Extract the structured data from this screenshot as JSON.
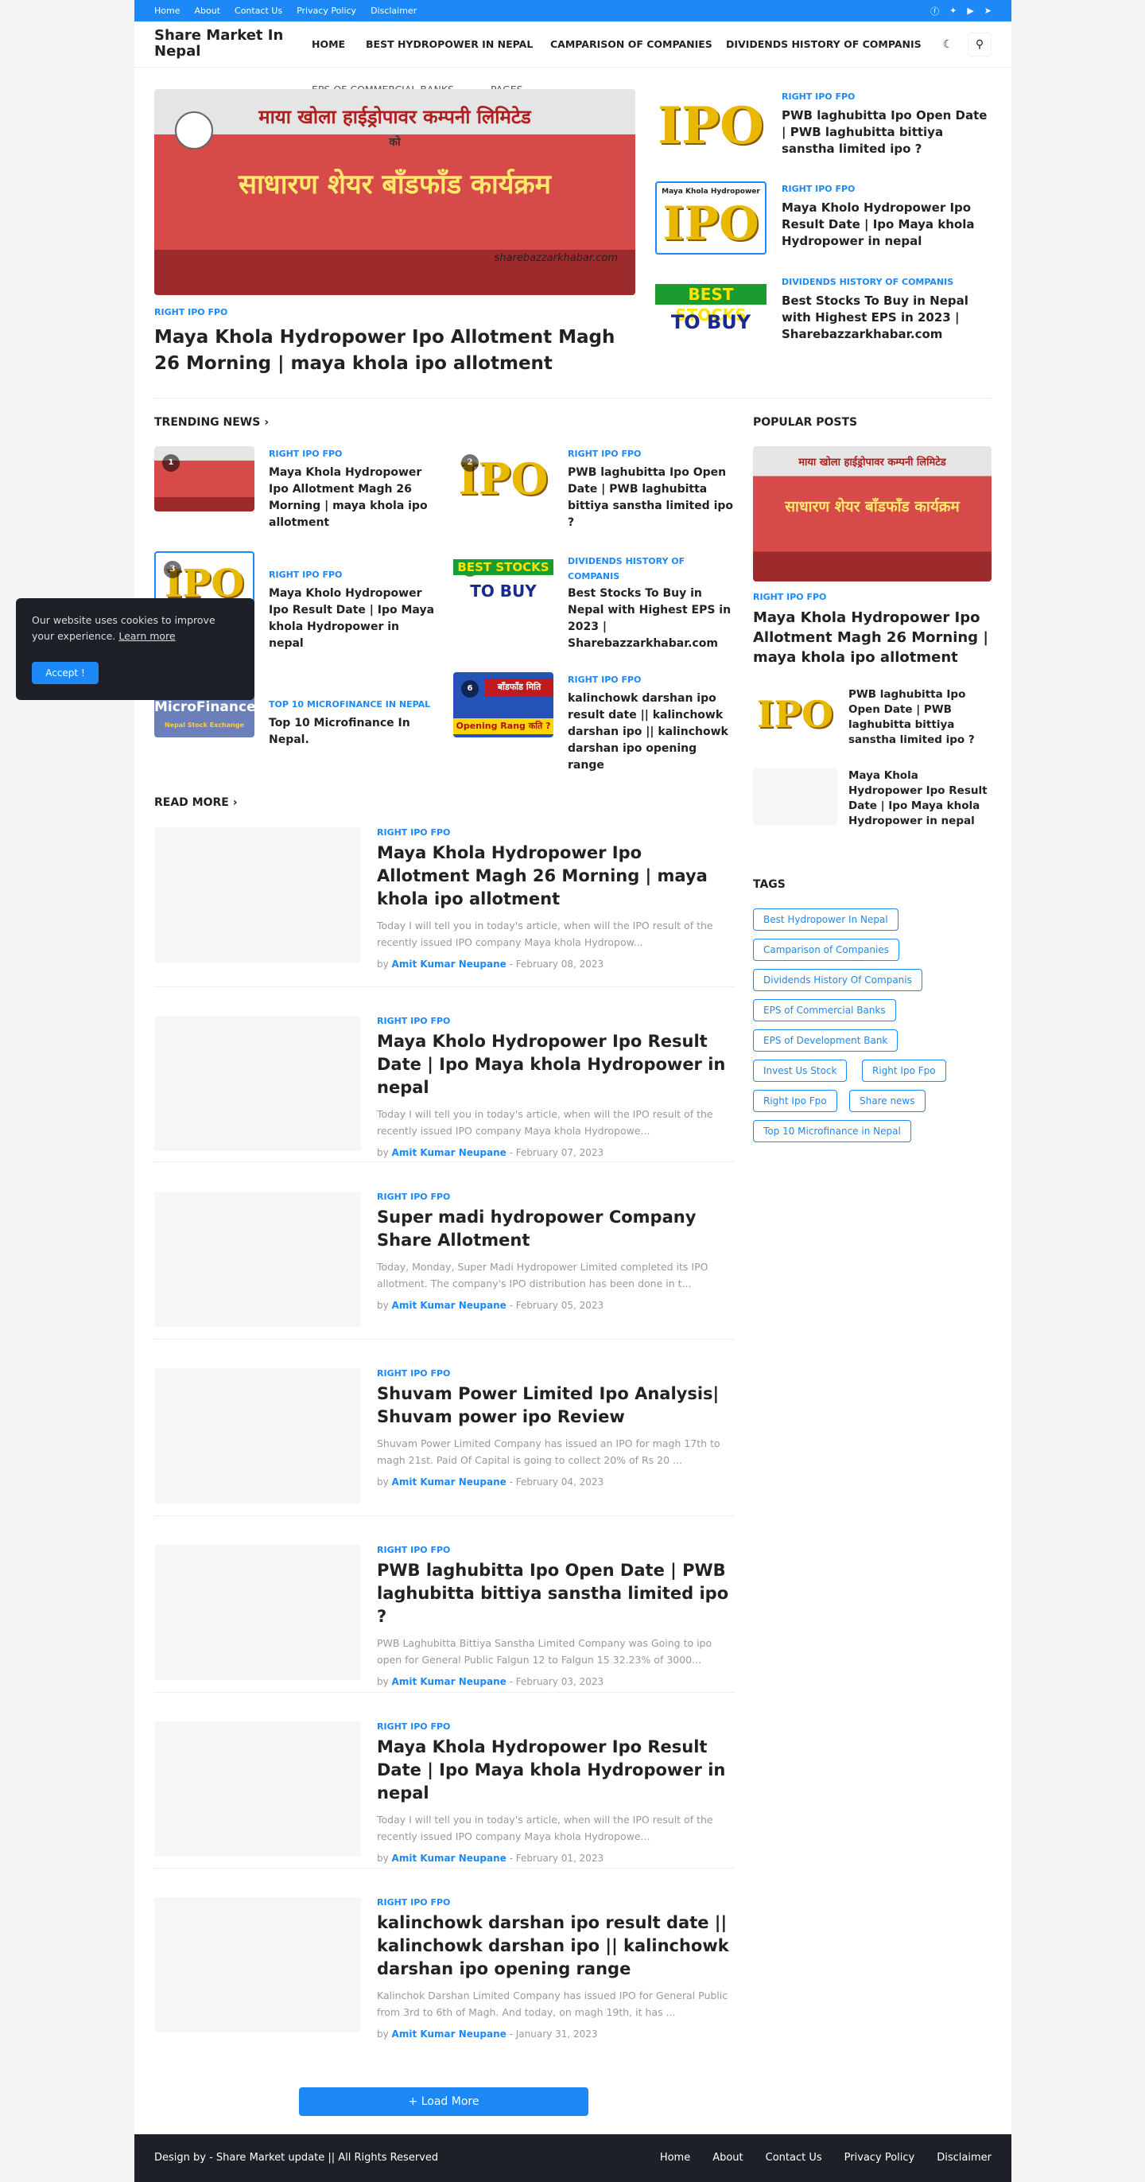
{
  "topbar": {
    "links": [
      "Home",
      "About",
      "Contact Us",
      "Privacy Policy",
      "Disclaimer"
    ],
    "social": [
      "facebook-icon",
      "twitter-icon",
      "youtube-icon",
      "telegram-icon"
    ]
  },
  "site": {
    "title": "Share Market In Nepal"
  },
  "nav": {
    "items": [
      "HOME",
      "BEST HYDROPOWER IN NEPAL",
      "CAMPARISON OF COMPANIES",
      "DIVIDENDS HISTORY OF COMPANIS",
      "EPS OF COMMERCIAL BANKS",
      "PAGES"
    ]
  },
  "hero": {
    "main": {
      "category": "RIGHT IPO FPO",
      "title": "Maya Khola Hydropower Ipo Allotment Magh 26 Morning | maya khola ipo allotment",
      "image_text_top": "माया खोला हाईड्रोपावर कम्पनी लिमिटेड",
      "image_text_mid": "को",
      "image_text_big": "साधारण शेयर बाँडफाँड कार्यक्रम",
      "image_watermark": "sharebazzarkhabar.com"
    },
    "side": [
      {
        "category": "RIGHT IPO FPO",
        "title": "PWB laghubitta Ipo Open Date | PWB laghubitta bittiya sanstha limited ipo ?",
        "img": "IPO"
      },
      {
        "category": "RIGHT IPO FPO",
        "title": "Maya Kholo Hydropower Ipo Result Date | Ipo Maya khola Hydropower in nepal",
        "img": "IPO",
        "img_caption": "Maya Khola Hydropower"
      },
      {
        "category": "DIVIDENDS HISTORY OF COMPANIS",
        "title": "Best Stocks To Buy in Nepal with Highest EPS in 2023 | Sharebazzarkhabar.com",
        "img_a": "BEST STOCKS",
        "img_b": "TO BUY"
      }
    ]
  },
  "trending": {
    "heading": "TRENDING NEWS",
    "items": [
      {
        "num": "1",
        "category": "RIGHT IPO FPO",
        "title": "Maya Khola Hydropower Ipo Allotment Magh 26 Morning | maya khola ipo allotment"
      },
      {
        "num": "2",
        "category": "RIGHT IPO FPO",
        "title": "PWB laghubitta Ipo Open Date | PWB laghubitta bittiya sanstha limited ipo ?"
      },
      {
        "num": "3",
        "category": "RIGHT IPO FPO",
        "title": "Maya Kholo Hydropower Ipo Result Date | Ipo Maya khola Hydropower in nepal"
      },
      {
        "num": "4",
        "category": "DIVIDENDS HISTORY OF COMPANIS",
        "title": "Best Stocks To Buy in Nepal with Highest EPS in 2023 | Sharebazzarkhabar.com"
      },
      {
        "num": "5",
        "category": "TOP 10 MICROFINANCE IN NEPAL",
        "title": "Top 10 Microfinance In Nepal.",
        "img_a": "MicroFinance",
        "img_b": "Nepal Stock Exchange"
      },
      {
        "num": "6",
        "category": "RIGHT IPO FPO",
        "title": "kalinchowk darshan ipo result date || kalinchowk darshan ipo || kalinchowk darshan ipo opening range",
        "img_a": "बाँडफाँड मिति",
        "img_b": "Opening Rang कति ?"
      }
    ]
  },
  "readmore": {
    "heading": "READ MORE",
    "posts": [
      {
        "category": "RIGHT IPO FPO",
        "title": "Maya Khola Hydropower Ipo Allotment Magh 26 Morning | maya khola ipo allotment",
        "snippet": "Today I will tell you in today's article, when will the IPO result of the recently issued IPO company  Maya khola Hydropow...",
        "by": "by",
        "author": "Amit Kumar Neupane",
        "date": "- February 08, 2023"
      },
      {
        "category": "RIGHT IPO FPO",
        "title": "Maya Kholo Hydropower Ipo Result Date | Ipo Maya khola Hydropower in nepal",
        "snippet": "Today I will tell you in today's article, when will the IPO result of the recently issued IPO company  Maya khola Hydropowe...",
        "by": "by",
        "author": "Amit Kumar Neupane",
        "date": "- February 07, 2023"
      },
      {
        "category": "RIGHT IPO FPO",
        "title": "Super madi hydropower Company Share Allotment",
        "snippet": "Today, Monday, Super Madi Hydropower Limited completed its IPO allotment. The company's IPO distribution has been done in t...",
        "by": "by",
        "author": "Amit Kumar Neupane",
        "date": "- February 05, 2023"
      },
      {
        "category": "RIGHT IPO FPO",
        "title": "Shuvam Power Limited Ipo Analysis| Shuvam power ipo Review",
        "snippet": "Shuvam Power Limited Company has issued an IPO for magh 17th to magh 21st. Paid Of Capital  is going to collect 20% of Rs 20 ...",
        "by": "by",
        "author": "Amit Kumar Neupane",
        "date": "- February 04, 2023"
      },
      {
        "category": "RIGHT IPO FPO",
        "title": "PWB laghubitta Ipo Open Date | PWB laghubitta bittiya sanstha limited ipo ?",
        "snippet": "PWB Laghubitta Bittiya Sanstha Limited Company was Going to ipo open for General Public Falgun 12 to Falgun 15 32.23% of 3000...",
        "by": "by",
        "author": "Amit Kumar Neupane",
        "date": "- February 03, 2023"
      },
      {
        "category": "RIGHT IPO FPO",
        "title": "Maya Khola Hydropower Ipo Result Date | Ipo Maya khola Hydropower in nepal",
        "snippet": "Today I will tell you in today's article, when will the IPO result of the recently issued IPO company Maya khola Hydropowe...",
        "by": "by",
        "author": "Amit Kumar Neupane",
        "date": "- February 01, 2023"
      },
      {
        "category": "RIGHT IPO FPO",
        "title": "kalinchowk darshan ipo result date || kalinchowk darshan ipo || kalinchowk darshan ipo opening range",
        "snippet": "Kalinchok Darshan Limited Company has issued IPO for General Public from 3rd to 6th of Magh. And today, on magh 19th, it has ...",
        "by": "by",
        "author": "Amit Kumar Neupane",
        "date": "- January 31, 2023"
      }
    ],
    "load_more": "+ Load More"
  },
  "popular": {
    "heading": "POPULAR POSTS",
    "main": {
      "category": "RIGHT IPO FPO",
      "title": "Maya Khola Hydropower Ipo Allotment Magh 26 Morning | maya khola ipo allotment"
    },
    "list": [
      {
        "title": "PWB laghubitta Ipo Open Date | PWB laghubitta bittiya sanstha limited ipo ?"
      },
      {
        "title": "Maya Khola Hydropower Ipo Result Date | Ipo Maya khola Hydropower in nepal"
      }
    ]
  },
  "tags": {
    "heading": "TAGS",
    "items": [
      "Best Hydropower In Nepal",
      "Camparison of Companies",
      "Dividends History Of Companis",
      "EPS of Commercial Banks",
      "EPS of Development Bank",
      "Invest Us Stock",
      "Right Ipo Fpo",
      "Right Ipo Fpo",
      "Share news",
      "Top 10 Microfinance in Nepal"
    ]
  },
  "cookie": {
    "text": "Our website uses cookies to improve your experience.",
    "link": "Learn more",
    "button": "Accept !"
  },
  "footer": {
    "credit": "Design by - Share Market update || All Rights Reserved",
    "links": [
      "Home",
      "About",
      "Contact Us",
      "Privacy Policy",
      "Disclaimer"
    ]
  },
  "colors": {
    "accent": "#1c89f7",
    "footer": "#1d2026"
  }
}
